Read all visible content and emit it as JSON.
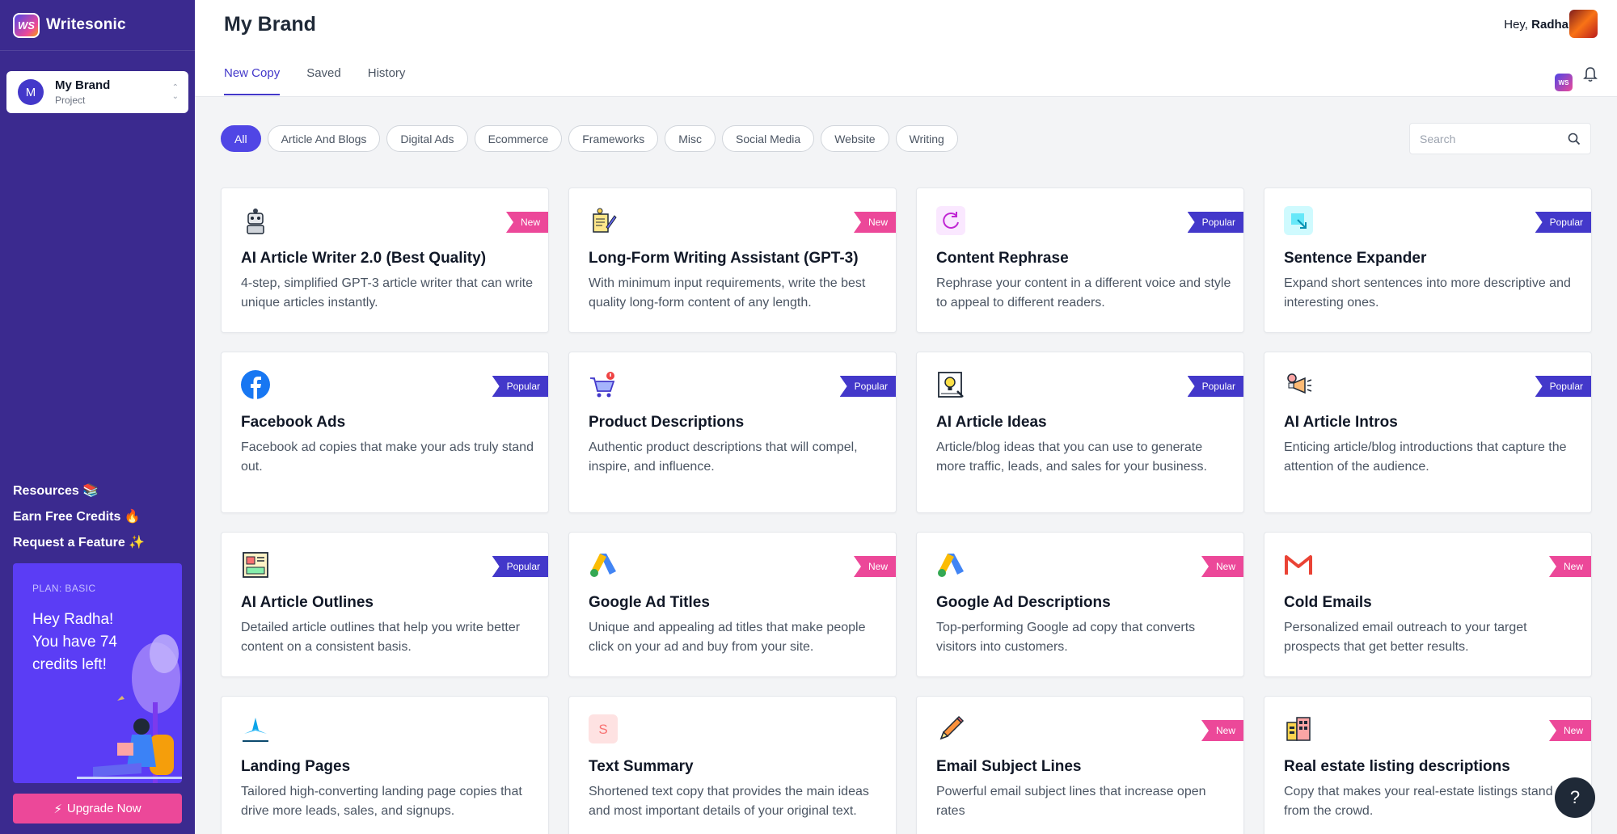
{
  "brand": {
    "logo_mark": "WS",
    "name": "Writesonic"
  },
  "project": {
    "avatar_letter": "M",
    "name": "My Brand",
    "type": "Project"
  },
  "sidebar_links": [
    {
      "label": "Resources 📚"
    },
    {
      "label": "Earn Free Credits 🔥"
    },
    {
      "label": "Request a Feature ✨"
    }
  ],
  "plan": {
    "label": "PLAN: BASIC",
    "message": "Hey Radha! You have 74 credits left!"
  },
  "upgrade": {
    "label": "Upgrade Now"
  },
  "header": {
    "title": "My Brand",
    "greeting_prefix": "Hey, ",
    "user_name": "Radha",
    "ws_mini": "WS"
  },
  "tabs": [
    {
      "label": "New Copy",
      "active": true
    },
    {
      "label": "Saved"
    },
    {
      "label": "History"
    }
  ],
  "filters": [
    {
      "label": "All",
      "active": true
    },
    {
      "label": "Article And Blogs"
    },
    {
      "label": "Digital Ads"
    },
    {
      "label": "Ecommerce"
    },
    {
      "label": "Frameworks"
    },
    {
      "label": "Misc"
    },
    {
      "label": "Social Media"
    },
    {
      "label": "Website"
    },
    {
      "label": "Writing"
    }
  ],
  "search": {
    "placeholder": "Search"
  },
  "cards": [
    {
      "title": "AI Article Writer 2.0 (Best Quality)",
      "desc": "4-step, simplified GPT-3 article writer that can write unique articles instantly.",
      "badge": "New",
      "icon": "robot-icon"
    },
    {
      "title": "Long-Form Writing Assistant (GPT-3)",
      "desc": "With minimum input requirements, write the best quality long-form content of any length.",
      "badge": "New",
      "icon": "writing-pad-icon"
    },
    {
      "title": "Content Rephrase",
      "desc": "Rephrase your content in a different voice and style to appeal to different readers.",
      "badge": "Popular",
      "icon": "rephrase-icon"
    },
    {
      "title": "Sentence Expander",
      "desc": "Expand short sentences into more descriptive and interesting ones.",
      "badge": "Popular",
      "icon": "expand-icon"
    },
    {
      "title": "Facebook Ads",
      "desc": "Facebook ad copies that make your ads truly stand out.",
      "badge": "Popular",
      "icon": "facebook-icon"
    },
    {
      "title": "Product Descriptions",
      "desc": "Authentic product descriptions that will compel, inspire, and influence.",
      "badge": "Popular",
      "icon": "cart-icon"
    },
    {
      "title": "AI Article Ideas",
      "desc": "Article/blog ideas that you can use to generate more traffic, leads, and sales for your business.",
      "badge": "Popular",
      "icon": "idea-board-icon"
    },
    {
      "title": "AI Article Intros",
      "desc": "Enticing article/blog introductions that capture the attention of the audience.",
      "badge": "Popular",
      "icon": "megaphone-icon"
    },
    {
      "title": "AI Article Outlines",
      "desc": "Detailed article outlines that help you write better content on a consistent basis.",
      "badge": "Popular",
      "icon": "newspaper-icon"
    },
    {
      "title": "Google Ad Titles",
      "desc": "Unique and appealing ad titles that make people click on your ad and buy from your site.",
      "badge": "New",
      "icon": "google-ads-icon"
    },
    {
      "title": "Google Ad Descriptions",
      "desc": "Top-performing Google ad copy that converts visitors into customers.",
      "badge": "New",
      "icon": "google-ads-icon"
    },
    {
      "title": "Cold Emails",
      "desc": "Personalized email outreach to your target prospects that get better results.",
      "badge": "New",
      "icon": "gmail-icon"
    },
    {
      "title": "Landing Pages",
      "desc": "Tailored high-converting landing page copies that drive more leads, sales, and signups.",
      "badge": "",
      "icon": "landing-icon"
    },
    {
      "title": "Text Summary",
      "desc": "Shortened text copy that provides the main ideas and most important details of your original text.",
      "badge": "",
      "icon": "summary-icon"
    },
    {
      "title": "Email Subject Lines",
      "desc": "Powerful email subject lines that increase open rates",
      "badge": "New",
      "icon": "pencil-icon"
    },
    {
      "title": "Real estate listing descriptions",
      "desc": "Copy that makes your real-estate listings stand out from the crowd.",
      "badge": "New",
      "icon": "building-icon"
    }
  ],
  "help": {
    "label": "?"
  }
}
